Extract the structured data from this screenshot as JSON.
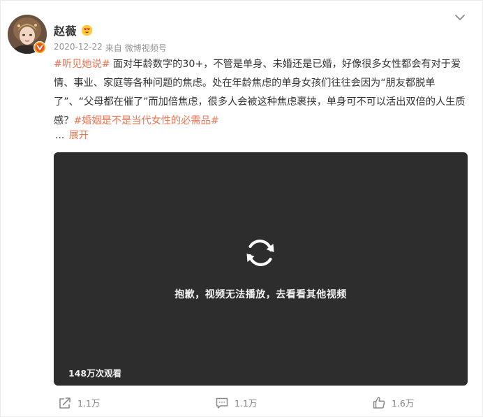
{
  "post": {
    "author": {
      "name": "赵薇"
    },
    "meta": {
      "time": "2020-12-22",
      "from_label": "来自",
      "source": "微博视频号"
    },
    "text": {
      "topic1": "#听见她说#",
      "body": " 面对年龄数字的30+，不管是单身、未婚还是已婚，好像很多女性都会有对于爱情、事业、家庭等各种问题的焦虑。处在年龄焦虑的单身女孩们往往会因为“朋友都脱单了”、“父母都在催了”而加倍焦虑，很多人会被这种焦虑裹挟，单身可不可以活出双倍的人生质感？",
      "topic2": "#婚姻是不是当代女性的必需品#"
    },
    "expand": {
      "ellipsis": "...",
      "label": "展开"
    },
    "video": {
      "message": "抱歉，视频无法播放，去看看其他视频",
      "views": "148万次观看"
    },
    "actions": {
      "repost": "1.1万",
      "comment": "1.1万",
      "like": "1.6万"
    }
  },
  "icons": {
    "more": "chevron-down-icon",
    "member": "heart-eyes-emoji-icon",
    "verify": "verified-badge-icon",
    "refresh": "refresh-icon",
    "repost": "repost-icon",
    "comment": "comment-icon",
    "like": "like-icon"
  },
  "colors": {
    "topic": "#eb7350",
    "meta": "#939393",
    "video_bg": "#2d2d2d",
    "action": "#808080"
  }
}
